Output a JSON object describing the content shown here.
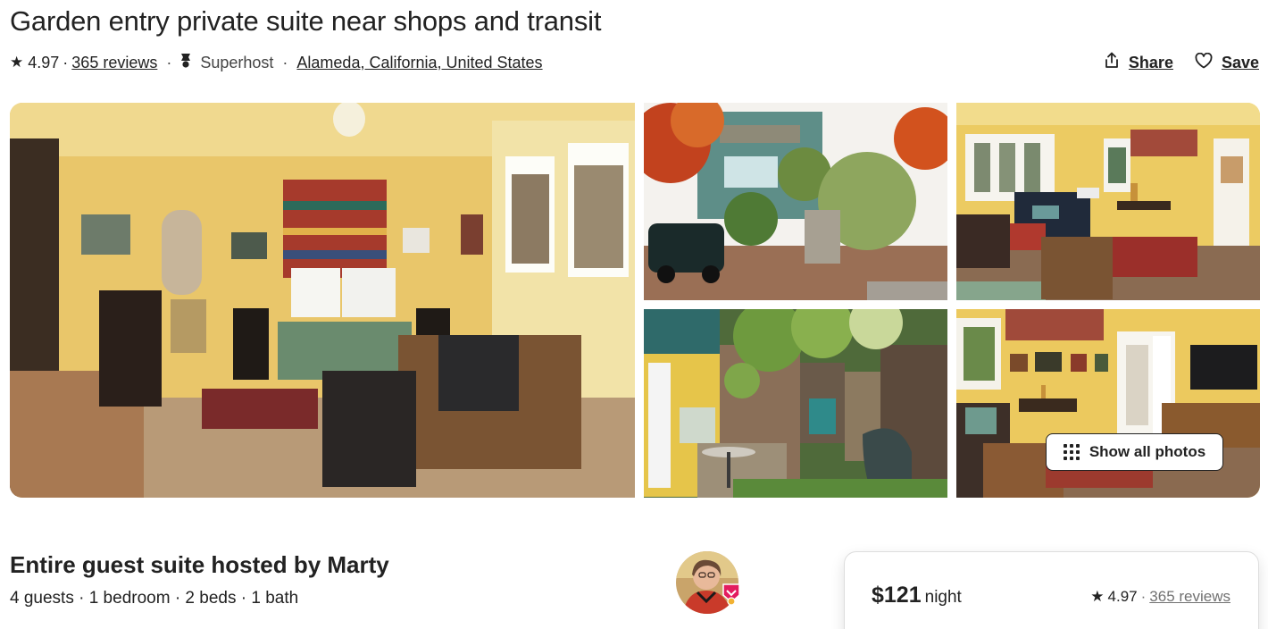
{
  "listing": {
    "title": "Garden entry private suite near shops and transit",
    "rating": "4.97",
    "reviews": "365 reviews",
    "superhost": "Superhost",
    "location": "Alameda, California, United States"
  },
  "actions": {
    "share": "Share",
    "save": "Save"
  },
  "gallery": {
    "show_all": "Show all photos"
  },
  "host": {
    "title": "Entire guest suite hosted by Marty",
    "details": "4 guests · 1 bedroom · 2 beds · 1 bath"
  },
  "booking": {
    "price": "$121",
    "per": "night",
    "rating": "4.97",
    "reviews": "365 reviews"
  },
  "icons": {
    "star": "star-icon",
    "superhost": "medal-icon",
    "share": "share-icon",
    "save": "heart-icon",
    "grid": "grid-icon"
  },
  "colors": {
    "text": "#222222",
    "muted": "#717171",
    "border": "#dddddd",
    "badge": "#e31c5f"
  }
}
